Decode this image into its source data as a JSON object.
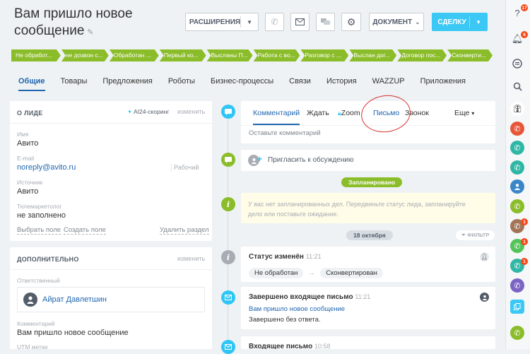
{
  "header": {
    "title_line1": "Вам пришло новое",
    "title_line2": "сообщение",
    "btn_extensions": "РАСШИРЕНИЯ",
    "btn_document": "ДОКУМЕНТ",
    "btn_deal": "СДЕЛКУ"
  },
  "stages": [
    "Не обработ...",
    "не дозвон с...",
    "Обработан ...",
    "Первый ко...",
    "Высланы П...",
    "Работа с во...",
    "Разговор с ...",
    "Выслан дог...",
    "Договор пос...",
    "Сконверти..."
  ],
  "tabs": [
    "Общие",
    "Товары",
    "Предложения",
    "Роботы",
    "Бизнес-процессы",
    "Связи",
    "История",
    "WAZZUP",
    "Приложения"
  ],
  "about": {
    "title": "О ЛИДЕ",
    "scoring": "AI24-скоринг",
    "edit": "изменить",
    "name_label": "Имя",
    "name_value": "Авито",
    "email_label": "E-mail",
    "email_value": "noreply@avito.ru",
    "email_type": "Рабочий",
    "source_label": "Источник",
    "source_value": "Авито",
    "marketer_label": "Телемаркетолог",
    "marketer_value": "не заполнено",
    "choose_field": "Выбрать поле",
    "create_field": "Создать поле",
    "delete_section": "Удалить раздел"
  },
  "extra": {
    "title": "ДОПОЛНИТЕЛЬНО",
    "edit": "изменить",
    "responsible_label": "Ответственный",
    "responsible_value": "Айрат Давлетшин",
    "comment_label": "Комментарий",
    "comment_value": "Вам пришло новое сообщение",
    "cut_label": "UTM метки"
  },
  "activity": {
    "tabs": [
      "Комментарий",
      "Ждать",
      "Zoom",
      "Письмо",
      "Звонок",
      "Еще"
    ],
    "placeholder": "Оставьте комментарий",
    "invite": "Пригласить к обсуждению",
    "planned": "Запланировано",
    "no_plans_line1": "У вас нет запланированных дел. Передвиньте статус лида, запланируйте",
    "no_plans_line2": "дело или поставьте ожидание.",
    "date": "18 октября",
    "filter": "ФИЛЬТР"
  },
  "timeline": [
    {
      "title": "Статус изменён",
      "time": "11:21",
      "from": "Не обработан",
      "to": "Сконвертирован"
    },
    {
      "title": "Завершено входящее письмо",
      "time": "11:21",
      "subject": "Вам пришло новое сообщение",
      "text": "Завершено без ответа."
    },
    {
      "title": "Входящее письмо",
      "time": "10:58"
    }
  ],
  "rightbar": {
    "badge1": "17",
    "badge2": "6",
    "badge3": "1",
    "badge4": "1",
    "badge5": "1"
  },
  "colors": {
    "accent": "#2067b0",
    "stage": "#8bbd2a",
    "deal": "#3bc8f5",
    "annotation": "#d9302c"
  }
}
